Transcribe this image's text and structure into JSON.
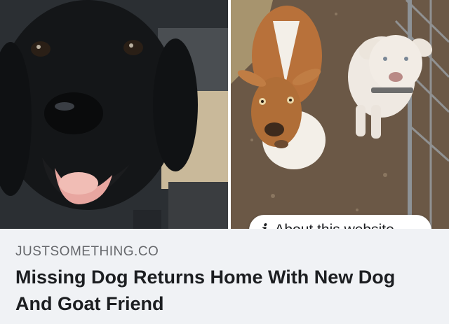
{
  "link_preview": {
    "domain": "JUSTSOMETHING.CO",
    "headline": "Missing Dog Returns Home With New Dog And Goat Friend",
    "about_button": {
      "label": "About this website",
      "icon": "info-icon",
      "icon_glyph": "i"
    }
  },
  "images": [
    {
      "subject": "black-dog-photo"
    },
    {
      "subject": "goat-and-white-dog-photo"
    }
  ],
  "colors": {
    "caption_background": "#f0f2f5",
    "domain_text": "#65676b",
    "headline_text": "#1c1e21",
    "pill_background": "#ffffff"
  }
}
